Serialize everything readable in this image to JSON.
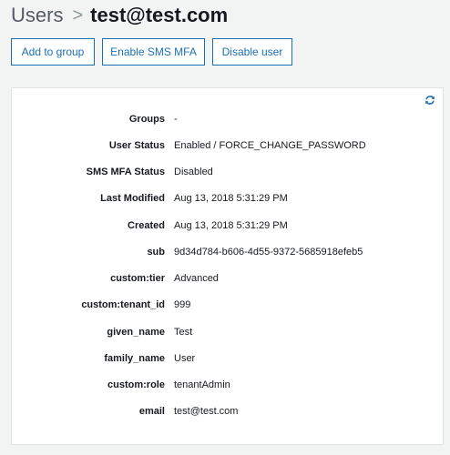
{
  "breadcrumb": {
    "parent": "Users",
    "separator": ">",
    "current": "test@test.com"
  },
  "actions": {
    "add_to_group": "Add to group",
    "enable_sms_mfa": "Enable SMS MFA",
    "disable_user": "Disable user"
  },
  "panel": {
    "refresh_icon": "refresh-icon",
    "accent_color": "#1b70b5"
  },
  "attributes": [
    {
      "label": "Groups",
      "value": "-"
    },
    {
      "label": "User Status",
      "value": "Enabled / FORCE_CHANGE_PASSWORD"
    },
    {
      "label": "SMS MFA Status",
      "value": "Disabled"
    },
    {
      "label": "Last Modified",
      "value": "Aug 13, 2018 5:31:29 PM"
    },
    {
      "label": "Created",
      "value": "Aug 13, 2018 5:31:29 PM"
    },
    {
      "label": "sub",
      "value": "9d34d784-b606-4d55-9372-5685918efeb5"
    },
    {
      "label": "custom:tier",
      "value": "Advanced"
    },
    {
      "label": "custom:tenant_id",
      "value": "999"
    },
    {
      "label": "given_name",
      "value": "Test"
    },
    {
      "label": "family_name",
      "value": "User"
    },
    {
      "label": "custom:role",
      "value": "tenantAdmin"
    },
    {
      "label": "email",
      "value": "test@test.com"
    }
  ]
}
